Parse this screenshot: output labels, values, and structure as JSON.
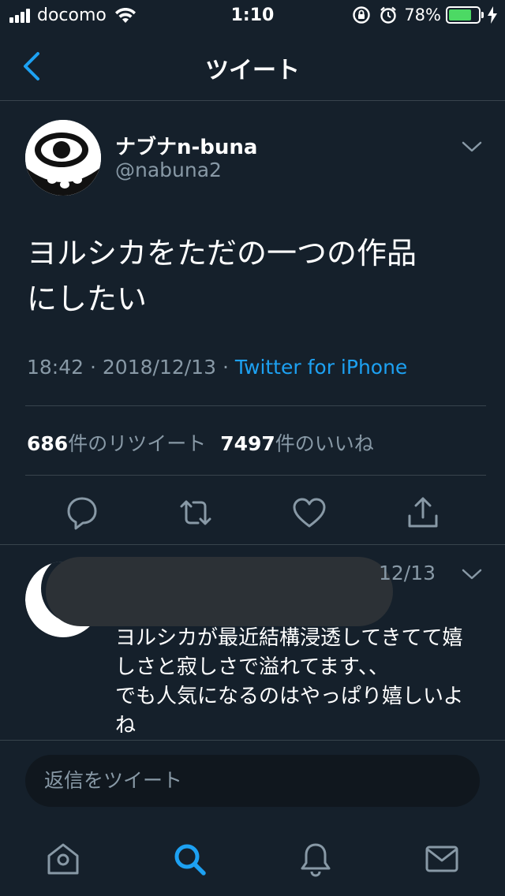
{
  "status_bar": {
    "carrier": "docomo",
    "time": "1:10",
    "battery_percent": "78%",
    "battery_level": 0.78,
    "battery_color": "#4cd964"
  },
  "nav": {
    "title": "ツイート",
    "back_icon": "chevron-left-icon"
  },
  "tweet": {
    "display_name": "ナブナn-buna",
    "handle": "@nabuna2",
    "text": "ヨルシカをただの一つの作品\nにしたい",
    "time": "18:42",
    "date": "2018/12/13",
    "source": "Twitter for iPhone",
    "retweet_count": "686",
    "retweet_label": "件のリツイート",
    "like_count": "7497",
    "like_label": "件のいいね"
  },
  "actions": [
    "reply-icon",
    "retweet-icon",
    "like-icon",
    "share-icon"
  ],
  "reply": {
    "date": "12/13",
    "text": "ヨルシカが最近結構浸透してきてて嬉\nしさと寂しさで溢れてます、、\nでも人気になるのはやっぱり嬉しいよ\nね"
  },
  "composer": {
    "placeholder": "返信をツイート"
  },
  "tabbar": [
    "home-icon",
    "search-icon",
    "notifications-icon",
    "messages-icon"
  ],
  "colors": {
    "background": "#15202b",
    "accent": "#1da1f2",
    "secondary_text": "#8899a6",
    "divider": "#38444d"
  }
}
